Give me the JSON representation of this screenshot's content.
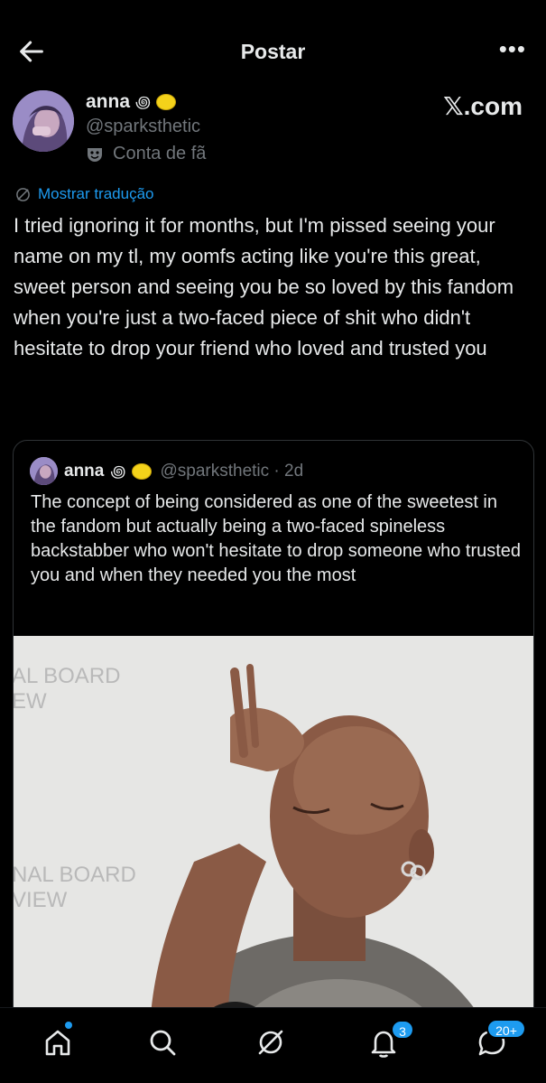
{
  "header": {
    "title": "Postar",
    "more_label": "•••"
  },
  "author": {
    "name": "anna",
    "handle": "@sparksthetic",
    "label": "Conta de fã",
    "emoji_spiral": "꩜",
    "brand": "𝕏.com"
  },
  "translate_label": "Mostrar tradução",
  "tweet_text": "I tried ignoring it for months, but I'm pissed seeing your name on my tl, my oomfs acting like you're this great, sweet person and seeing you be so loved by this fandom when you're just a two-faced piece of shit who didn't hesitate to drop your friend who loved and trusted you",
  "quote": {
    "name": "anna",
    "handle_time": "@sparksthetic · 2d",
    "emoji_spiral": "꩜",
    "text": "The concept of being considered as one of the sweetest in the fandom but actually being a two-faced spineless backstabber who won't hesitate to drop someone who trusted you and when they needed you the most",
    "media_backdrop_text": [
      "AL BOARD",
      "EW",
      "NAL BOARD",
      "VIEW"
    ]
  },
  "tabbar": {
    "items": [
      {
        "name": "home",
        "icon": "home-icon"
      },
      {
        "name": "search",
        "icon": "search-icon"
      },
      {
        "name": "grok",
        "icon": "grok-icon"
      },
      {
        "name": "notifications",
        "icon": "bell-icon",
        "badge": "3"
      },
      {
        "name": "messages",
        "icon": "message-icon",
        "badge": "20+"
      }
    ]
  },
  "colors": {
    "accent": "#1d9bf0",
    "background": "#000000",
    "text": "#e7e9ea",
    "muted": "#71767b"
  }
}
